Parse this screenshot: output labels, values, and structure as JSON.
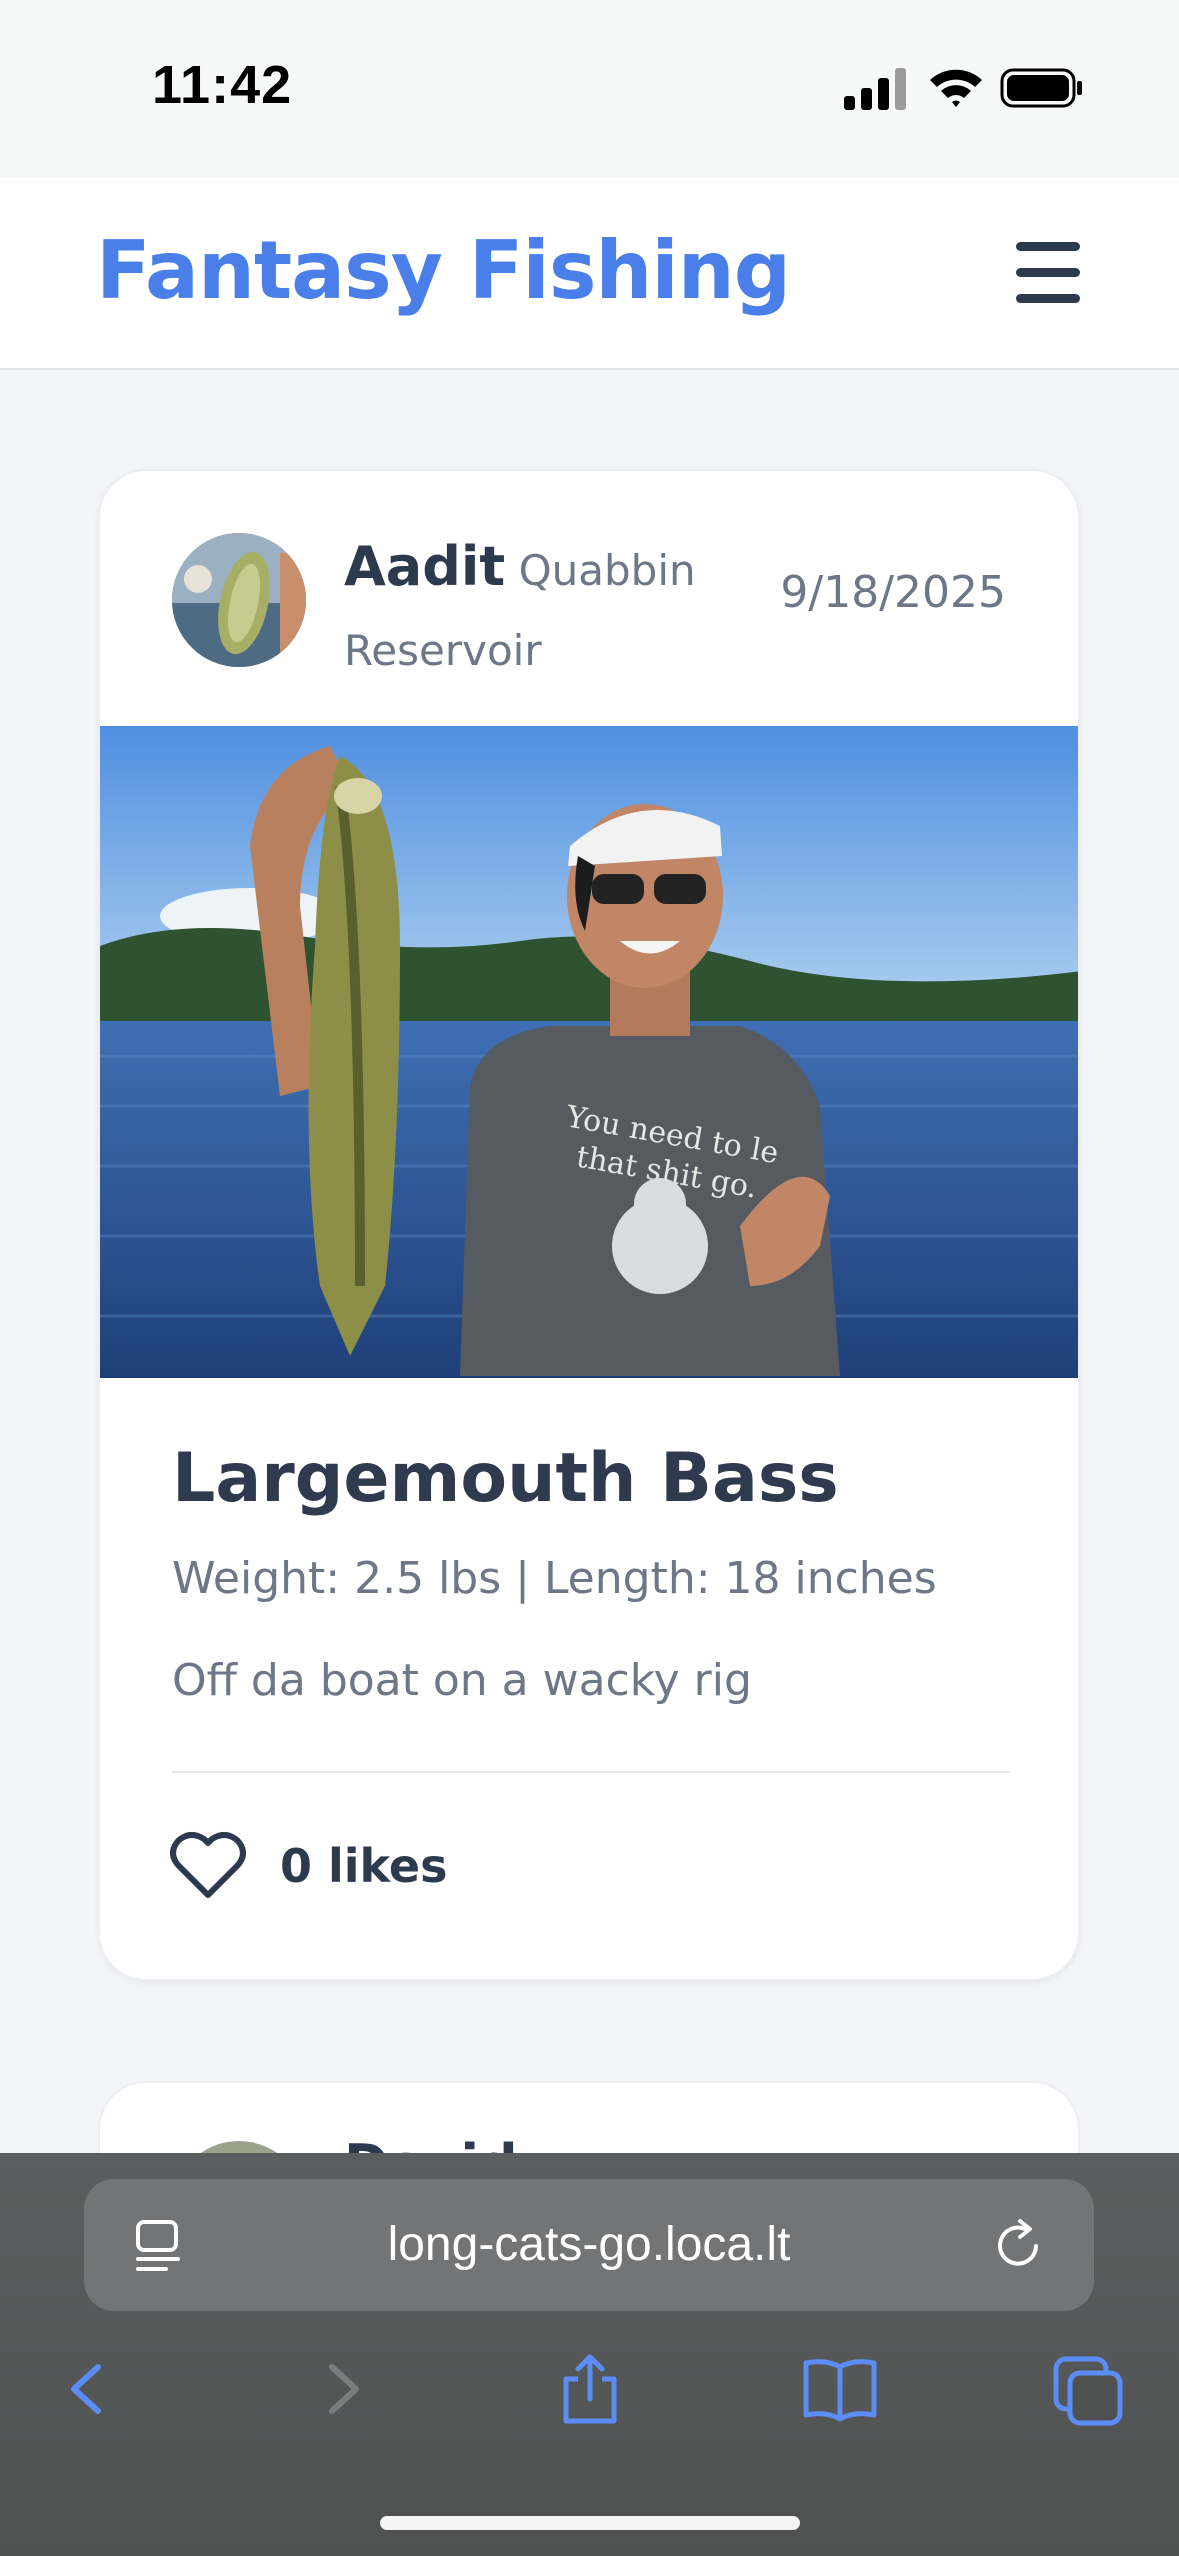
{
  "status_bar": {
    "time": "11:42"
  },
  "header": {
    "brand": "Fantasy Fishing",
    "menu_icon": "hamburger-menu-icon"
  },
  "posts": [
    {
      "author": "Aadit",
      "location": "Quabbin Reservoir",
      "date": "9/18/2025",
      "species": "Largemouth Bass",
      "stats": "Weight: 2.5 lbs | Length: 18 inches",
      "caption": "Off da boat on a wacky rig",
      "likes_label": "0 likes",
      "photo_shirt_text": [
        "You need to le",
        "that shit go."
      ]
    },
    {
      "author": "David"
    }
  ],
  "browser": {
    "url": "long-cats-go.loca.lt",
    "icons": [
      "reader-icon",
      "reload-icon",
      "back-icon",
      "forward-icon",
      "share-icon",
      "bookmarks-icon",
      "tabs-icon"
    ]
  },
  "colors": {
    "brand": "#4a7ee8",
    "text_dark": "#2d3a4e",
    "text_muted": "#6e7787",
    "browser_accent": "#5b8cf7"
  }
}
